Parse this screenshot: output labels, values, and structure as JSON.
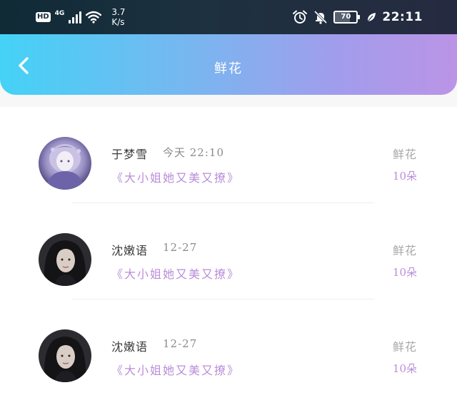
{
  "status_bar": {
    "hd_label": "HD",
    "network_label": "4G",
    "speed_value": "3.7",
    "speed_unit": "K/s",
    "battery_level": "70",
    "time": "22:11",
    "icons": [
      "alarm-icon",
      "mute-bell-icon",
      "battery-icon",
      "leaf-icon"
    ]
  },
  "header": {
    "title": "鲜花",
    "back_icon": "chevron-left-icon"
  },
  "items": [
    {
      "name": "于梦雪",
      "time": "今天 22:10",
      "book": "《大小姐她又美又撩》",
      "gift": "鲜花",
      "count": "10朵"
    },
    {
      "name": "沈嫩语",
      "time": "12-27",
      "book": "《大小姐她又美又撩》",
      "gift": "鲜花",
      "count": "10朵"
    },
    {
      "name": "沈嫩语",
      "time": "12-27",
      "book": "《大小姐她又美又撩》",
      "gift": "鲜花",
      "count": "10朵"
    }
  ],
  "colors": {
    "header_gradient_start": "#44d2f6",
    "header_gradient_end": "#bb94e6",
    "accent_purple": "#b98ed8"
  }
}
